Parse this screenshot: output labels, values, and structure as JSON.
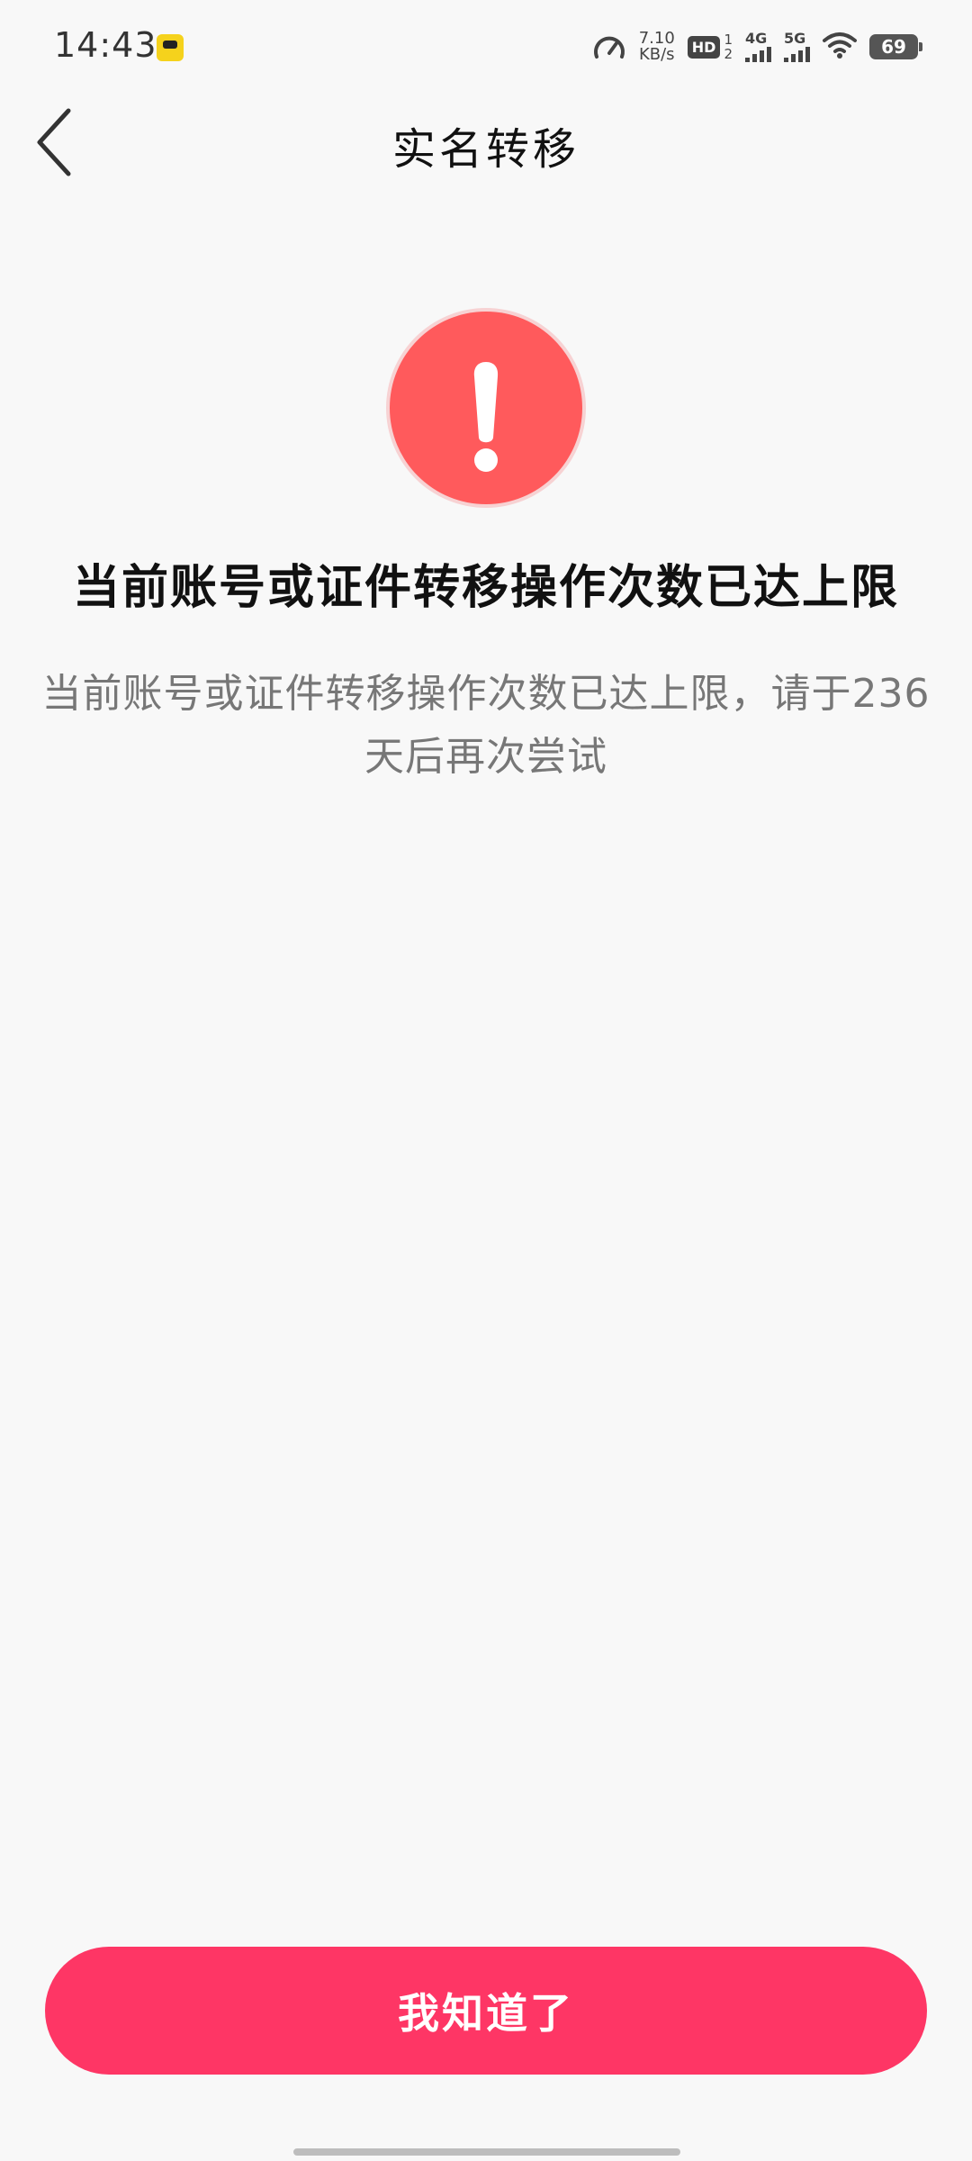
{
  "status_bar": {
    "time": "14:43",
    "net_speed_value": "7.10",
    "net_speed_unit": "KB/s",
    "hd_label": "HD",
    "sim_slot_top": "1",
    "sim_slot_bottom": "2",
    "signal_1_label": "4G",
    "signal_2_label": "5G",
    "battery_level": "69"
  },
  "nav": {
    "title": "实名转移"
  },
  "alert": {
    "icon": "exclamation-icon",
    "color": "#ff5a5c",
    "title": "当前账号或证件转移操作次数已达上限",
    "description": "当前账号或证件转移操作次数已达上限，请于236天后再次尝试"
  },
  "actions": {
    "confirm_label": "我知道了",
    "confirm_color": "#fe3665"
  }
}
